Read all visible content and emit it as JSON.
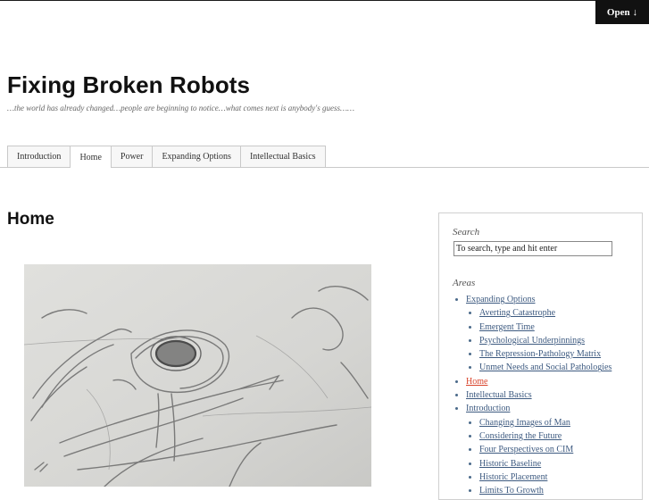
{
  "header": {
    "open_label": "Open",
    "open_icon": "down-arrow-icon",
    "site_title": "Fixing Broken Robots",
    "tagline": "…the world has already changed…people are beginning to notice…what comes next is anybody's guess……"
  },
  "nav": {
    "tabs": [
      {
        "label": "Introduction"
      },
      {
        "label": "Home",
        "active": true
      },
      {
        "label": "Power"
      },
      {
        "label": "Expanding Options"
      },
      {
        "label": "Intellectual Basics"
      }
    ]
  },
  "main": {
    "page_title": "Home",
    "featured_image": "pencil-sketch-robot"
  },
  "sidebar": {
    "search_title": "Search",
    "search_placeholder": "To search, type and hit enter",
    "areas_title": "Areas",
    "areas": {
      "expanding_options": "Expanding Options",
      "averting_catastrophe": "Averting Catastrophe",
      "emergent_time": "Emergent Time",
      "psychological_underpinnings": "Psychological Underpinnings",
      "repression_pathology_matrix": "The Repression-Pathology Matrix",
      "unmet_needs": "Unmet Needs and Social Pathologies",
      "home": "Home",
      "intellectual_basics": "Intellectual Basics",
      "introduction": "Introduction",
      "changing_images": "Changing Images of Man",
      "considering_future": "Considering the Future",
      "four_perspectives": "Four Perspectives on CIM",
      "historic_baseline": "Historic Baseline",
      "historic_placement": "Historic Placement",
      "limits_to_growth": "Limits To Growth"
    }
  },
  "colors": {
    "link": "#3d5a80",
    "current_link": "#d9442c",
    "open_tab_bg": "#111111"
  }
}
